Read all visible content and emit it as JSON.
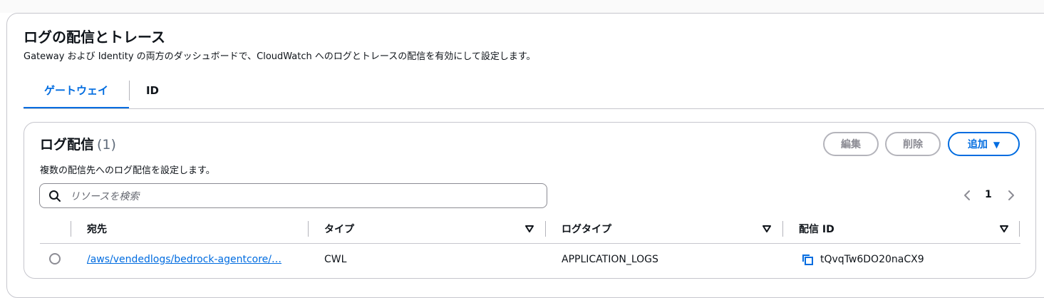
{
  "section": {
    "title": "ログの配信とトレース",
    "description": "Gateway および Identity の両方のダッシュボードで、CloudWatch へのログとトレースの配信を有効にして設定します。"
  },
  "tabs": [
    {
      "label": "ゲートウェイ",
      "active": true
    },
    {
      "label": "ID",
      "active": false
    }
  ],
  "panel": {
    "title": "ログ配信",
    "count": "(1)",
    "description": "複数の配信先へのログ配信を設定します。",
    "buttons": {
      "edit": "編集",
      "delete": "削除",
      "add": "追加"
    },
    "search_placeholder": "リソースを検索",
    "page": "1"
  },
  "table": {
    "headers": [
      "宛先",
      "タイプ",
      "ログタイプ",
      "配信 ID"
    ],
    "rows": [
      {
        "destination": "/aws/vendedlogs/bedrock-agentcore/…",
        "type": "CWL",
        "log_type": "APPLICATION_LOGS",
        "delivery_id": "tQvqTw6DO20naCX9"
      }
    ]
  },
  "icons": {
    "search": "search-icon",
    "sort": "sort-caret-down-icon",
    "copy": "copy-icon",
    "prev": "chevron-left-icon",
    "next": "chevron-right-icon",
    "dropdown": "caret-down-icon"
  },
  "colors": {
    "accent": "#006ce0",
    "border": "#c6c6cd",
    "text": "#0f141a",
    "disabled": "#8c8c94"
  }
}
